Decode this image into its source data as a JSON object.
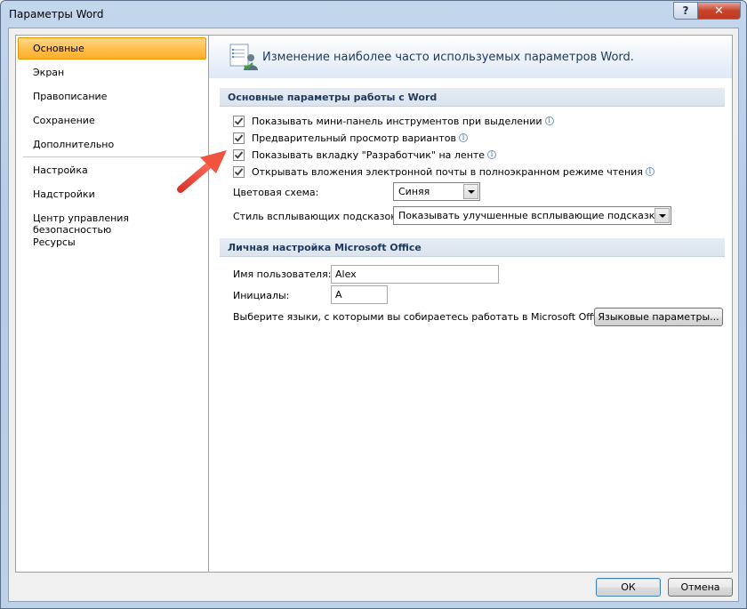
{
  "window": {
    "title": "Параметры Word",
    "help_label": "?",
    "close_label": "✕"
  },
  "nav": {
    "items": [
      {
        "label": "Основные",
        "active": true
      },
      {
        "label": "Экран"
      },
      {
        "label": "Правописание"
      },
      {
        "label": "Сохранение"
      },
      {
        "label": "Дополнительно"
      },
      {
        "label": "Настройка"
      },
      {
        "label": "Надстройки"
      },
      {
        "label": "Центр управления безопасностью"
      },
      {
        "label": "Ресурсы"
      }
    ]
  },
  "header": {
    "text": "Изменение наиболее часто используемых параметров Word."
  },
  "section1": {
    "title": "Основные параметры работы с Word",
    "checkboxes": [
      {
        "label": "Показывать мини-панель инструментов при выделении",
        "checked": true
      },
      {
        "label": "Предварительный просмотр вариантов",
        "checked": true
      },
      {
        "label": "Показывать вкладку \"Разработчик\" на ленте",
        "checked": true
      },
      {
        "label": "Открывать вложения электронной почты в полноэкранном режиме чтения",
        "checked": true
      }
    ],
    "color_scheme_label": "Цветовая схема:",
    "color_scheme_value": "Синяя",
    "tooltip_style_label": "Стиль всплывающих подсказок:",
    "tooltip_style_value": "Показывать улучшенные всплывающие подсказки"
  },
  "section2": {
    "title": "Личная настройка Microsoft Office",
    "username_label": "Имя пользователя:",
    "username_value": "Alex",
    "initials_label": "Инициалы:",
    "initials_value": "A",
    "languages_text": "Выберите языки, с которыми вы собираетесь работать в Microsoft Office:",
    "languages_button": "Языковые параметры..."
  },
  "footer": {
    "ok_label": "ОК",
    "cancel_label": "Отмена"
  },
  "colors": {
    "nav_active": "#ffc04f",
    "section_header_text": "#1e395b",
    "annotation_arrow": "#e8453c"
  }
}
